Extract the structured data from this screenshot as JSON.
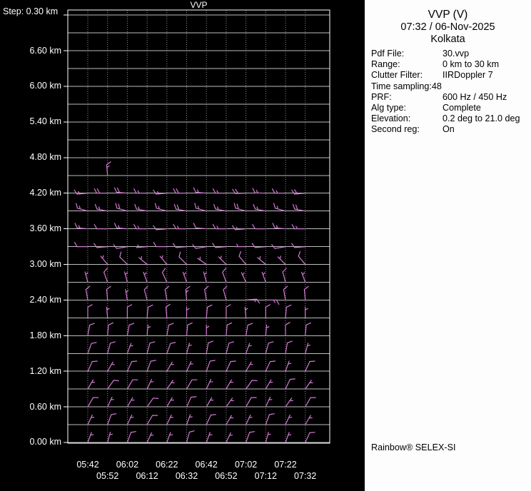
{
  "chart_data": {
    "type": "scatter",
    "subtype": "wind-barb-time-height-profile",
    "title": "VVP",
    "step_label": "Step: 0.30 km",
    "x_tick_labels": [
      "05:42",
      "05:52",
      "06:02",
      "06:12",
      "06:22",
      "06:32",
      "06:42",
      "06:52",
      "07:02",
      "07:12",
      "07:22",
      "07:32"
    ],
    "y_tick_labels": [
      "6.60 km",
      "6.00 km",
      "5.40 km",
      "4.80 km",
      "4.20 km",
      "3.60 km",
      "3.00 km",
      "2.40 km",
      "1.80 km",
      "1.20 km",
      "0.60 km",
      "0.00 km"
    ],
    "y_step_km": 0.3,
    "ylim_km": [
      0.0,
      7.28
    ],
    "grid": true,
    "legend": "none",
    "levels": [
      {
        "h": 0.0,
        "barbs": [
          [
            20,
            5
          ],
          [
            15,
            5
          ],
          [
            20,
            10
          ],
          [
            25,
            5
          ],
          [
            20,
            5
          ],
          [
            15,
            10
          ],
          [
            20,
            5
          ],
          [
            25,
            5
          ],
          [
            20,
            10
          ],
          [
            15,
            5
          ],
          [
            20,
            5
          ],
          [
            25,
            10
          ]
        ]
      },
      {
        "h": 0.3,
        "barbs": [
          [
            25,
            5
          ],
          [
            20,
            10
          ],
          [
            25,
            5
          ],
          [
            30,
            10
          ],
          [
            25,
            5
          ],
          [
            20,
            5
          ],
          [
            25,
            10
          ],
          [
            30,
            5
          ],
          [
            25,
            5
          ],
          [
            20,
            10
          ],
          [
            25,
            5
          ],
          [
            30,
            5
          ]
        ]
      },
      {
        "h": 0.6,
        "barbs": [
          [
            30,
            10
          ],
          [
            25,
            5
          ],
          [
            30,
            5
          ],
          [
            35,
            10
          ],
          [
            30,
            5
          ],
          [
            25,
            10
          ],
          [
            30,
            5
          ],
          [
            35,
            5
          ],
          [
            30,
            10
          ],
          [
            25,
            5
          ],
          [
            35,
            5
          ],
          [
            30,
            10
          ]
        ]
      },
      {
        "h": 0.9,
        "barbs": [
          [
            30,
            5
          ],
          [
            35,
            10
          ],
          [
            30,
            10
          ],
          [
            25,
            5
          ],
          [
            35,
            5
          ],
          [
            30,
            10
          ],
          [
            25,
            5
          ],
          [
            30,
            5
          ],
          [
            35,
            10
          ],
          [
            30,
            5
          ],
          [
            25,
            10
          ],
          [
            35,
            5
          ]
        ]
      },
      {
        "h": 1.2,
        "barbs": [
          [
            25,
            10
          ],
          [
            30,
            5
          ],
          [
            25,
            10
          ],
          [
            20,
            10
          ],
          [
            30,
            5
          ],
          [
            25,
            5
          ],
          [
            20,
            10
          ],
          [
            25,
            10
          ],
          [
            30,
            5
          ],
          [
            25,
            10
          ],
          [
            20,
            5
          ],
          [
            25,
            10
          ]
        ]
      },
      {
        "h": 1.5,
        "barbs": [
          [
            20,
            10
          ],
          [
            15,
            10
          ],
          [
            20,
            5
          ],
          [
            15,
            10
          ],
          [
            20,
            10
          ],
          [
            15,
            5
          ],
          [
            10,
            10
          ],
          [
            15,
            10
          ],
          [
            20,
            5
          ],
          [
            15,
            10
          ],
          [
            10,
            10
          ],
          [
            15,
            5
          ]
        ]
      },
      {
        "h": 1.8,
        "barbs": [
          [
            10,
            10
          ],
          [
            5,
            10
          ],
          [
            10,
            10
          ],
          [
            5,
            5
          ],
          [
            10,
            10
          ],
          [
            5,
            10
          ],
          [
            0,
            5
          ],
          [
            5,
            10
          ],
          [
            10,
            10
          ],
          [
            5,
            5
          ],
          [
            0,
            10
          ],
          [
            5,
            10
          ]
        ]
      },
      {
        "h": 2.1,
        "barbs": [
          [
            0,
            10
          ],
          [
            355,
            5
          ],
          [
            0,
            10
          ],
          [
            5,
            10
          ],
          [
            355,
            10
          ],
          [
            0,
            5
          ],
          [
            5,
            10
          ],
          [
            0,
            10
          ],
          [
            355,
            5
          ],
          [
            0,
            10
          ],
          [
            5,
            10
          ],
          [
            0,
            5
          ]
        ]
      },
      {
        "h": 2.4,
        "barbs": [
          [
            350,
            10
          ],
          [
            355,
            10
          ],
          [
            350,
            5
          ],
          [
            345,
            10
          ],
          [
            350,
            10
          ],
          [
            355,
            15
          ],
          [
            350,
            10
          ],
          [
            345,
            10
          ],
          [
            85,
            15
          ],
          [
            90,
            15
          ],
          [
            350,
            10
          ],
          [
            355,
            10
          ]
        ]
      },
      {
        "h": 2.7,
        "barbs": [
          [
            345,
            5
          ],
          [
            340,
            10
          ],
          [
            345,
            5
          ],
          [
            340,
            5
          ],
          [
            335,
            10
          ],
          [
            340,
            5
          ],
          [
            345,
            5
          ],
          [
            340,
            10
          ],
          [
            335,
            5
          ],
          [
            340,
            5
          ],
          [
            345,
            10
          ],
          [
            340,
            5
          ]
        ]
      },
      {
        "h": 3.0,
        "barbs": [
          null,
          [
            320,
            5
          ],
          [
            315,
            10
          ],
          [
            310,
            5
          ],
          [
            320,
            5
          ],
          [
            315,
            10
          ],
          [
            305,
            5
          ],
          [
            315,
            5
          ],
          [
            320,
            10
          ],
          [
            310,
            5
          ],
          [
            315,
            5
          ],
          [
            320,
            10
          ]
        ]
      },
      {
        "h": 3.3,
        "barbs": [
          [
            270,
            10
          ],
          [
            265,
            10
          ],
          [
            260,
            10
          ],
          [
            265,
            5
          ],
          [
            270,
            10
          ],
          [
            265,
            10
          ],
          [
            260,
            10
          ],
          [
            265,
            10
          ],
          [
            270,
            5
          ],
          [
            265,
            10
          ],
          [
            260,
            10
          ],
          [
            265,
            10
          ]
        ]
      },
      {
        "h": 3.6,
        "barbs": [
          [
            275,
            15
          ],
          [
            270,
            10
          ],
          [
            275,
            15
          ],
          [
            270,
            15
          ],
          [
            265,
            10
          ],
          [
            270,
            15
          ],
          [
            275,
            10
          ],
          [
            270,
            15
          ],
          [
            265,
            15
          ],
          [
            270,
            10
          ],
          [
            275,
            15
          ],
          [
            270,
            15
          ]
        ]
      },
      {
        "h": 3.9,
        "barbs": [
          [
            285,
            15
          ],
          [
            280,
            15
          ],
          [
            285,
            20
          ],
          [
            280,
            15
          ],
          [
            285,
            15
          ],
          [
            280,
            20
          ],
          [
            285,
            15
          ],
          [
            280,
            15
          ],
          [
            285,
            20
          ],
          [
            280,
            15
          ],
          [
            285,
            15
          ],
          [
            280,
            20
          ]
        ]
      },
      {
        "h": 4.2,
        "barbs": [
          [
            265,
            15
          ],
          [
            270,
            20
          ],
          [
            275,
            20
          ],
          [
            270,
            15
          ],
          [
            265,
            15
          ],
          [
            270,
            20
          ],
          [
            275,
            15
          ],
          [
            270,
            15
          ],
          [
            268,
            20
          ],
          [
            272,
            15
          ],
          [
            270,
            15
          ],
          [
            265,
            20
          ]
        ]
      },
      {
        "h": 4.5,
        "barbs": [
          null,
          [
            355,
            15
          ],
          null,
          null,
          null,
          null,
          null,
          null,
          null,
          null,
          null,
          null
        ]
      }
    ]
  },
  "panel": {
    "title": "VVP (V)",
    "timestamp": "07:32 / 06-Nov-2025",
    "site": "Kolkata",
    "fields": [
      {
        "label": "Pdf File:",
        "value": "30.vvp"
      },
      {
        "label": "Range:",
        "value": "0 km to 30 km"
      },
      {
        "label": "Clutter Filter:",
        "value": "IIRDoppler 7"
      },
      {
        "label": "Time sampling:48",
        "value": ""
      },
      {
        "label": "PRF:",
        "value": "600 Hz / 450 Hz"
      },
      {
        "label": "Alg type:",
        "value": "Complete"
      },
      {
        "label": "Elevation:",
        "value": "0.2 deg to 21.0 deg"
      },
      {
        "label": "Second reg:",
        "value": "On"
      }
    ],
    "footer": "Rainbow® SELEX-SI"
  },
  "colors": {
    "background": "#000000",
    "panel_bg": "#fdfdfd",
    "axis_text": "#ffffff",
    "grid_line": "#bdbdbd",
    "grid_dot": "#8f8f8f",
    "plot_border": "#ffffff",
    "barb": "#d678d6"
  }
}
